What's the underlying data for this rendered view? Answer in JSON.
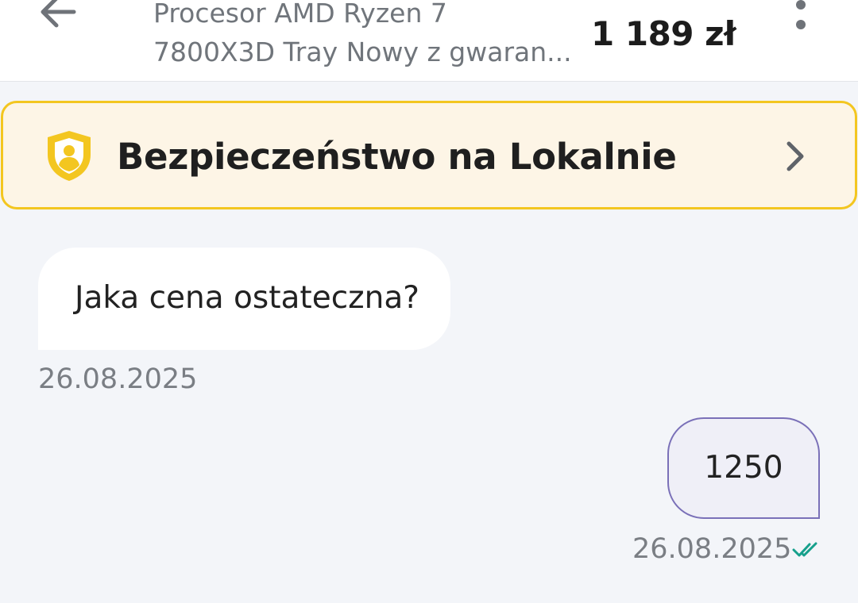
{
  "header": {
    "back_icon": "arrow-left-icon",
    "title_line1": "Procesor AMD Ryzen 7",
    "title_line2": "7800X3D Tray Nowy z gwaran...",
    "price": "1 189 zł",
    "menu_icon": "more-vertical-icon"
  },
  "banner": {
    "icon": "shield-user-icon",
    "label": "Bezpieczeństwo na Lokalnie",
    "chevron_icon": "chevron-right-icon",
    "accent_color": "#f3c620",
    "background_color": "#fdf5e6"
  },
  "messages": [
    {
      "direction": "incoming",
      "text": "Jaka cena ostateczna?",
      "date": "26.08.2025"
    },
    {
      "direction": "outgoing",
      "text": "1250",
      "date": "26.08.2025",
      "status_icon": "double-check-icon",
      "status_color": "#16a08c"
    }
  ],
  "colors": {
    "outgoing_border": "#7a70b8",
    "chat_background": "#f3f5f9"
  }
}
